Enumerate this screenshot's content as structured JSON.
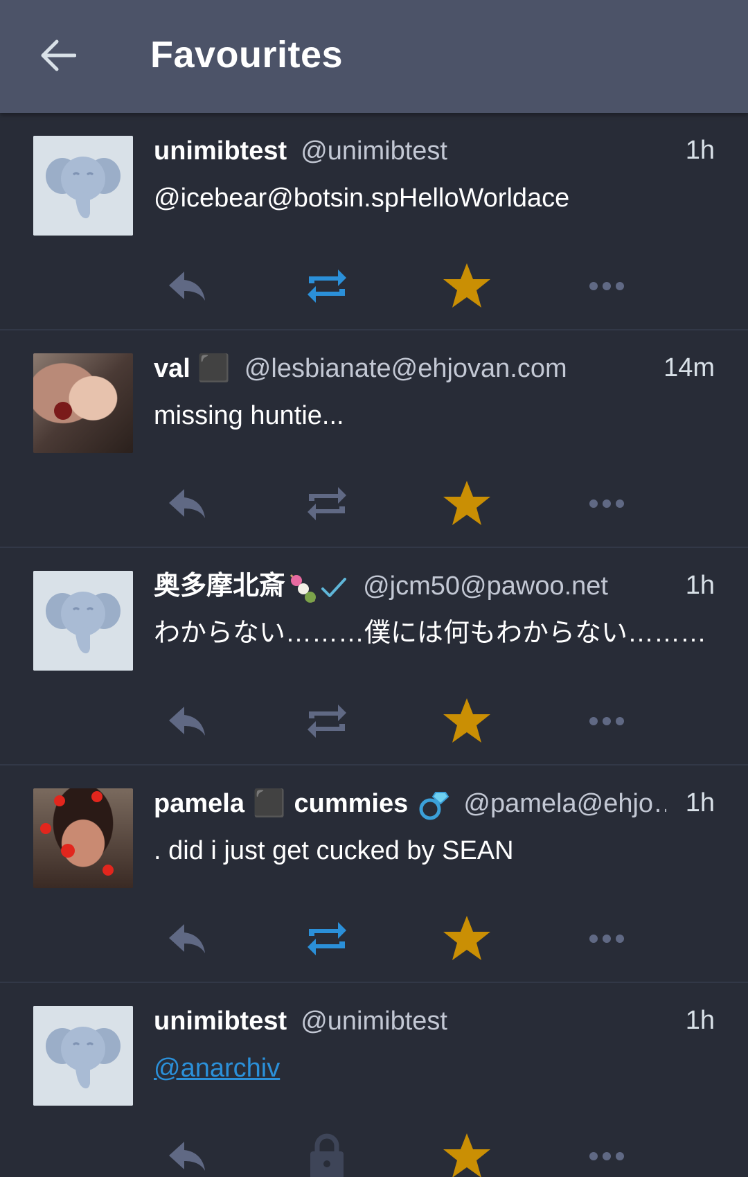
{
  "appbar": {
    "title": "Favourites",
    "back_icon": "arrow-left-icon",
    "background": "#4c5368"
  },
  "colors": {
    "background": "#282c37",
    "action_inactive": "#606984",
    "boost_active": "#2b90d9",
    "favourite_active": "#ca8f04",
    "link": "#2b90d9"
  },
  "statuses": [
    {
      "display_name": "unimibtest",
      "acct": "@unimibtest",
      "time": "1h",
      "content": "@icebear@botsin.spHelloWorldace",
      "avatar": "default-elephant-avatar",
      "boosted": true,
      "favourited": true,
      "boost_icon": "boost-icon"
    },
    {
      "display_name": "val ⬛",
      "acct": "@lesbianate@ehjovan.com",
      "time": "14m",
      "content": "missing huntie...",
      "avatar": "photo-avatar",
      "boosted": false,
      "favourited": true,
      "boost_icon": "boost-icon"
    },
    {
      "display_name": "奥多摩北斎",
      "acct": "@jcm50@pawoo.net",
      "time": "1h",
      "content": "わからない………僕には何もわからない………",
      "avatar": "default-elephant-avatar",
      "boosted": false,
      "favourited": true,
      "boost_icon": "boost-icon",
      "name_emojis": [
        "dango-emoji",
        "verified-check-icon"
      ]
    },
    {
      "display_name_part1": "pamela",
      "display_name_part2": "cummies",
      "acct": "@pamela@ehjo…",
      "time": "1h",
      "content": ". did i just get cucked by SEAN",
      "avatar": "photo-avatar",
      "boosted": true,
      "favourited": true,
      "boost_icon": "boost-icon",
      "name_emojis": [
        "ring-emoji"
      ]
    },
    {
      "display_name": "unimibtest",
      "acct": "@unimibtest",
      "time": "1h",
      "content": "@anarchiv",
      "avatar": "default-elephant-avatar",
      "boosted": false,
      "favourited": true,
      "boost_icon": "lock-icon"
    }
  ]
}
